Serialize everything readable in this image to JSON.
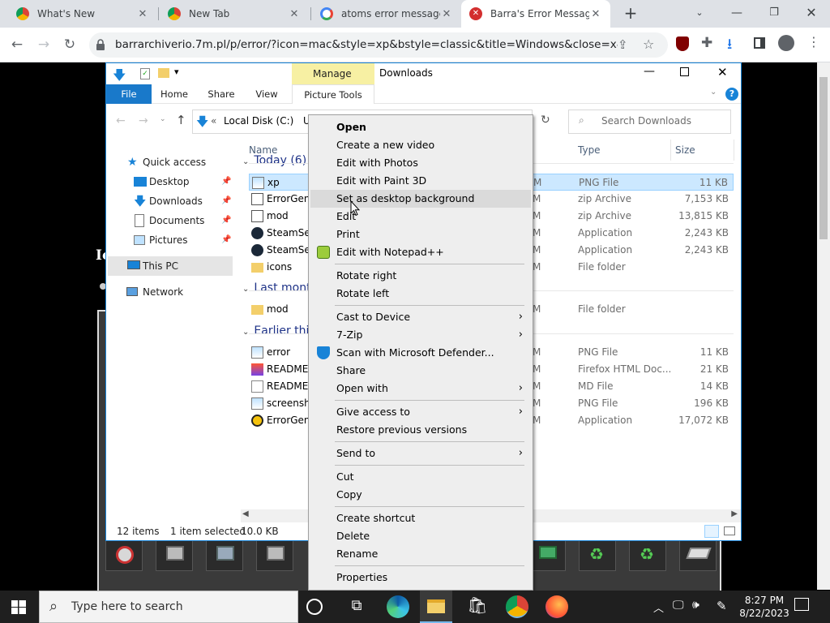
{
  "browser": {
    "tabs": [
      {
        "title": "What's New",
        "active": false
      },
      {
        "title": "New Tab",
        "active": false
      },
      {
        "title": "atoms error message g",
        "active": false
      },
      {
        "title": "Barra's Error Message",
        "active": true
      }
    ],
    "url": "barrarchiverio.7m.pl/p/error/?icon=mac&style=xp&bstyle=classic&title=Windows&close=x&text..."
  },
  "explorer": {
    "title": "Downloads",
    "ribbon": {
      "manage": "Manage",
      "tabs": [
        "File",
        "Home",
        "Share",
        "View",
        "Picture Tools"
      ]
    },
    "address": {
      "prefix": "«",
      "path1": "Local Disk (C:)",
      "path2": "U"
    },
    "search_placeholder": "Search Downloads",
    "nav": {
      "quick_access": "Quick access",
      "items": [
        "Desktop",
        "Downloads",
        "Documents",
        "Pictures"
      ],
      "this_pc": "This PC",
      "network": "Network"
    },
    "columns": {
      "name": "Name",
      "type": "Type",
      "size": "Size"
    },
    "groups": [
      {
        "label": "Today (6)",
        "files": [
          {
            "name": "xp",
            "date": "M",
            "type": "PNG File",
            "size": "11 KB",
            "selected": true,
            "icon": "png"
          },
          {
            "name": "ErrorGen-",
            "date": "M",
            "type": "zip Archive",
            "size": "7,153 KB",
            "icon": "zip"
          },
          {
            "name": "mod",
            "date": "M",
            "type": "zip Archive",
            "size": "13,815 KB",
            "icon": "zip"
          },
          {
            "name": "SteamSetu",
            "date": "M",
            "type": "Application",
            "size": "2,243 KB",
            "icon": "steam"
          },
          {
            "name": "SteamSetu",
            "date": "M",
            "type": "Application",
            "size": "2,243 KB",
            "icon": "steam"
          },
          {
            "name": "icons",
            "date": "M",
            "type": "File folder",
            "size": "",
            "icon": "folder"
          }
        ]
      },
      {
        "label": "Last month",
        "files": [
          {
            "name": "mod",
            "date": "M",
            "type": "File folder",
            "size": "",
            "icon": "folder"
          }
        ]
      },
      {
        "label": "Earlier this",
        "files": [
          {
            "name": "error",
            "date": "M",
            "type": "PNG File",
            "size": "11 KB",
            "icon": "png"
          },
          {
            "name": "README",
            "date": "M",
            "type": "Firefox HTML Doc...",
            "size": "21 KB",
            "icon": "html"
          },
          {
            "name": "README.r",
            "date": "M",
            "type": "MD File",
            "size": "14 KB",
            "icon": "doc"
          },
          {
            "name": "screensho",
            "date": "M",
            "type": "PNG File",
            "size": "196 KB",
            "icon": "png"
          },
          {
            "name": "ErrorGen",
            "date": "M",
            "type": "Application",
            "size": "17,072 KB",
            "icon": "radiation"
          }
        ]
      }
    ],
    "status": {
      "items": "12 items",
      "selected": "1 item selected",
      "size": "10.0 KB"
    }
  },
  "context_menu": {
    "groups": [
      [
        {
          "label": "Open",
          "bold": true
        },
        {
          "label": "Create a new video"
        },
        {
          "label": "Edit with Photos"
        },
        {
          "label": "Edit with Paint 3D"
        },
        {
          "label": "Set as desktop background",
          "highlight": true
        },
        {
          "label": "Edit"
        },
        {
          "label": "Print"
        },
        {
          "label": "Edit with Notepad++",
          "icon": "notepadpp"
        }
      ],
      [
        {
          "label": "Rotate right"
        },
        {
          "label": "Rotate left"
        }
      ],
      [
        {
          "label": "Cast to Device",
          "submenu": true
        },
        {
          "label": "7-Zip",
          "submenu": true
        },
        {
          "label": "Scan with Microsoft Defender...",
          "icon": "defender"
        },
        {
          "label": "Share"
        },
        {
          "label": "Open with",
          "submenu": true
        }
      ],
      [
        {
          "label": "Give access to",
          "submenu": true
        },
        {
          "label": "Restore previous versions"
        }
      ],
      [
        {
          "label": "Send to",
          "submenu": true
        }
      ],
      [
        {
          "label": "Cut"
        },
        {
          "label": "Copy"
        }
      ],
      [
        {
          "label": "Create shortcut"
        },
        {
          "label": "Delete"
        },
        {
          "label": "Rename"
        }
      ],
      [
        {
          "label": "Properties"
        }
      ]
    ]
  },
  "taskbar": {
    "search_placeholder": "Type here to search",
    "time": "8:27 PM",
    "date": "8/22/2023"
  },
  "page_fragments": {
    "l1": "Ic"
  },
  "colors": {
    "accent": "#1883d7",
    "selected_row": "#cce8ff",
    "manage_tab": "#f7f0a3",
    "file_tab": "#1979ca"
  }
}
